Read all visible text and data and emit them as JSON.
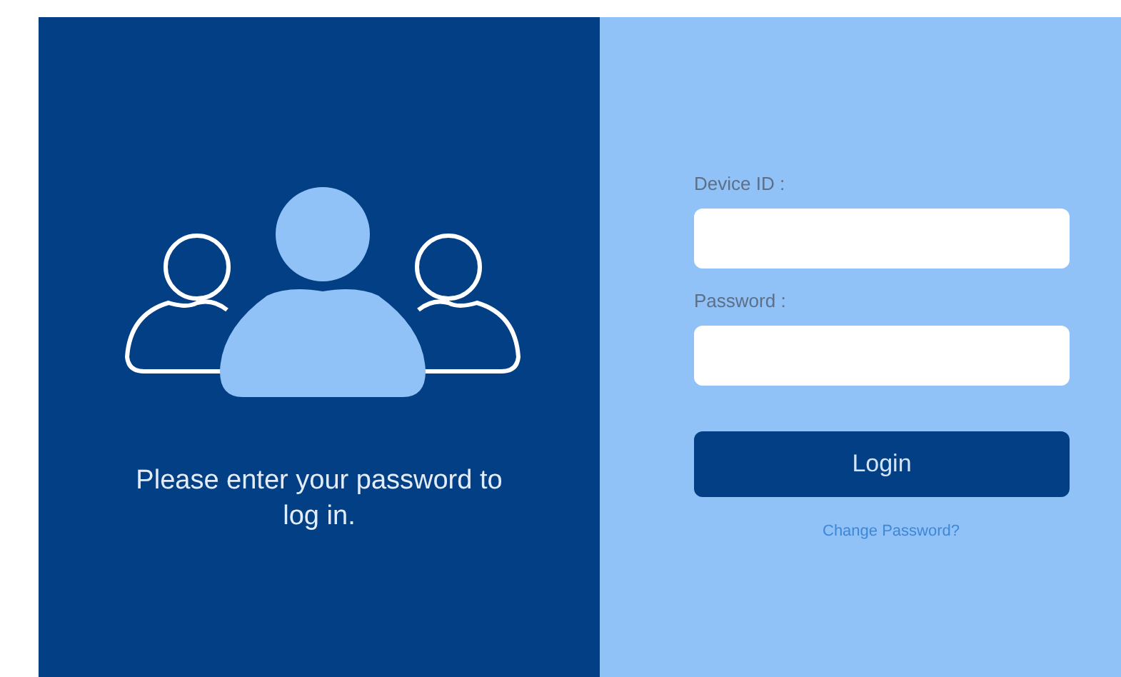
{
  "message": "Please enter your password to log in.",
  "fields": [
    {
      "label": "Device ID :"
    },
    {
      "label": "Password :"
    }
  ],
  "login_button": "Login",
  "change_password_link": "Change Password?"
}
